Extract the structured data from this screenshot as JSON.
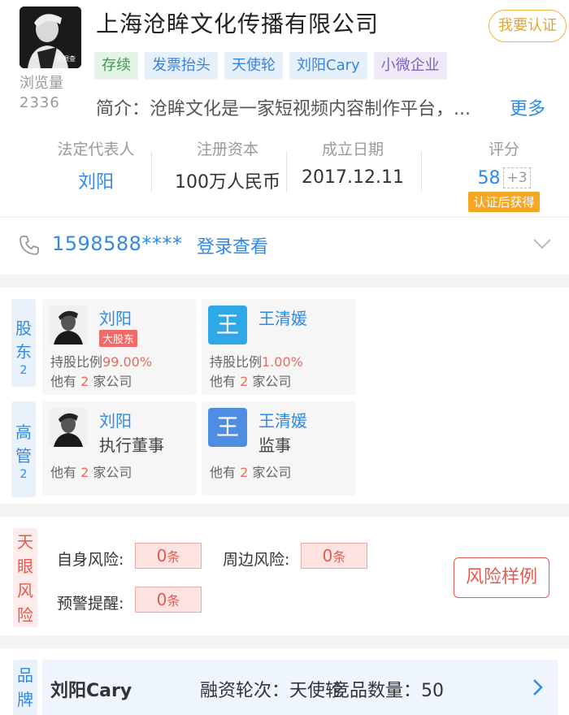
{
  "company": {
    "name": "上海沧眸文化传播有限公司",
    "claim_label": "我要认证",
    "logo_text": "天眼查",
    "views_label": "浏览量",
    "views_value": "2336",
    "tags": [
      "存续",
      "发票抬头",
      "天使轮",
      "刘阳Cary",
      "小微企业"
    ],
    "intro_label": "简介：",
    "intro_text": "沧眸文化是一家短视频内容制作平台，...",
    "more_label": "更多"
  },
  "stats": {
    "legal_rep_label": "法定代表人",
    "legal_rep_value": "刘阳",
    "capital_label": "注册资本",
    "capital_value": "100万人民币",
    "date_label": "成立日期",
    "date_value": "2017.12.11",
    "score_label": "评分",
    "score_value": "58",
    "score_plus": "+3",
    "score_badge": "认证后获得"
  },
  "phone": {
    "number": "1598588****",
    "login_label": "登录查看"
  },
  "shareholders": {
    "label_top": "股",
    "label_bottom": "东",
    "count": "2",
    "items": [
      {
        "name": "刘阳",
        "badge": "大股东",
        "share_label": "持股比例",
        "share_value": "99.00%",
        "other_prefix": "他有",
        "other_count": "2",
        "other_suffix": "家公司"
      },
      {
        "name": "王清媛",
        "avatar_char": "王",
        "share_label": "持股比例",
        "share_value": "1.00%",
        "other_prefix": "他有",
        "other_count": "2",
        "other_suffix": "家公司"
      }
    ]
  },
  "executives": {
    "label_top": "高",
    "label_bottom": "管",
    "count": "2",
    "items": [
      {
        "name": "刘阳",
        "role": "执行董事",
        "other_prefix": "他有",
        "other_count": "2",
        "other_suffix": "家公司"
      },
      {
        "name": "王清媛",
        "avatar_char": "王",
        "role": "监事",
        "other_prefix": "他有",
        "other_count": "2",
        "other_suffix": "家公司"
      }
    ]
  },
  "risk": {
    "side_chars": [
      "天",
      "眼",
      "风",
      "险"
    ],
    "self_label": "自身风险:",
    "self_value": "0",
    "around_label": "周边风险:",
    "around_value": "0",
    "warn_label": "预警提醒:",
    "warn_value": "0",
    "unit": "条",
    "example_label": "风险样例"
  },
  "brand": {
    "side_chars": [
      "品",
      "牌"
    ],
    "name": "刘阳Cary",
    "round_text": "融资轮次：天使轮",
    "count_text": "竞品数量：50"
  },
  "colors": {
    "accent_blue": "#2f8ae6",
    "risk_red": "#e35a4f",
    "claim_orange": "#e8a427"
  }
}
